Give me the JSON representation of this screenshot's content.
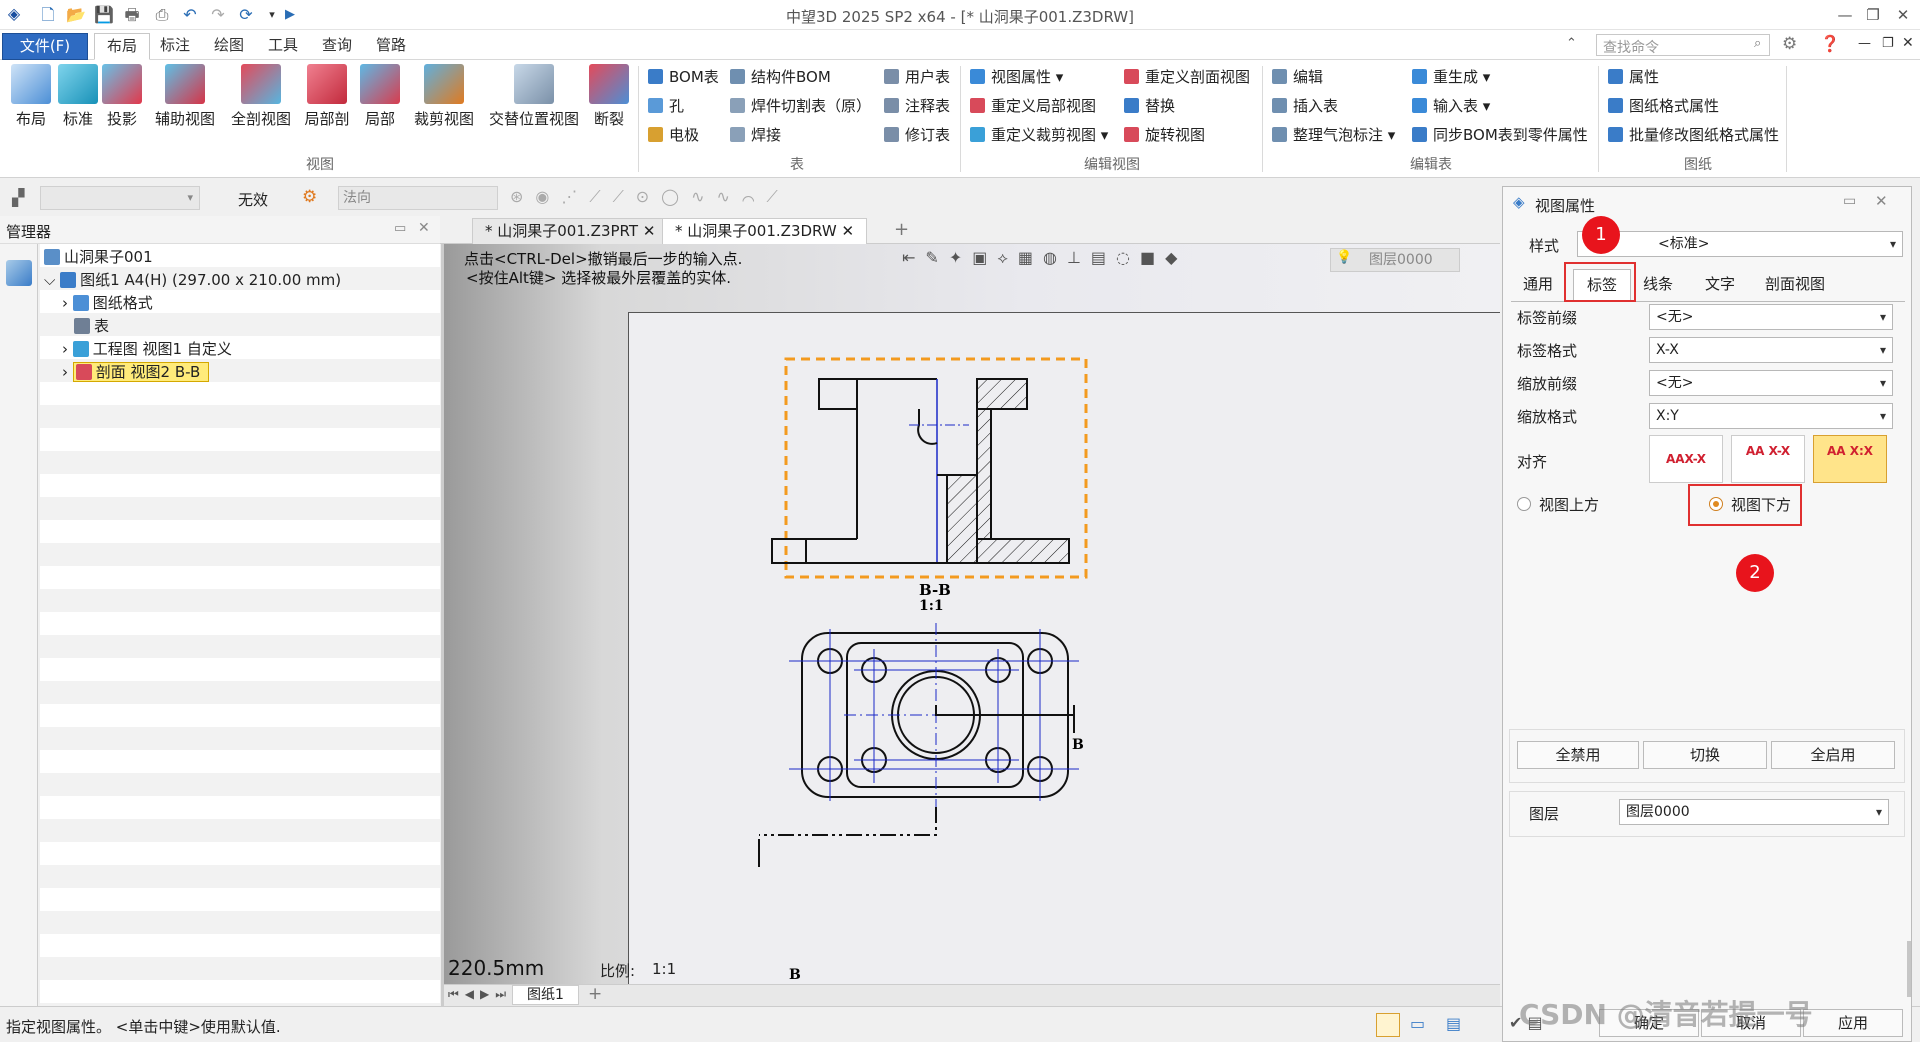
{
  "titlebar": {
    "title": "中望3D 2025 SP2 x64 - [* 山洞果子001.Z3DRW]"
  },
  "menu": {
    "file": "文件(F)",
    "tabs": [
      "布局",
      "标注",
      "绘图",
      "工具",
      "查询",
      "管路"
    ],
    "search_placeholder": "查找命令"
  },
  "ribbon": {
    "view_buttons": [
      "布局",
      "标准",
      "投影",
      "辅助视图",
      "全剖视图",
      "局部剖",
      "局部",
      "裁剪视图",
      "交替位置视图",
      "断裂"
    ],
    "view_group": "视图",
    "table_items": [
      "BOM表",
      "孔",
      "电极",
      "结构件BOM",
      "焊件切割表（原）",
      "焊接",
      "用户表",
      "注释表",
      "修订表"
    ],
    "table_group": "表",
    "edit_view_items": [
      "视图属性",
      "重定义局部视图",
      "重定义裁剪视图",
      "重定义剖面视图",
      "替换",
      "旋转视图"
    ],
    "edit_view_group": "编辑视图",
    "edit_table_items": [
      "编辑",
      "插入表",
      "整理气泡标注",
      "重生成",
      "输入表",
      "同步BOM表到零件属性"
    ],
    "edit_table_group": "编辑表",
    "sheet_items": [
      "属性",
      "图纸格式属性",
      "批量修改图纸格式属性"
    ],
    "sheet_group": "图纸"
  },
  "toolbar2": {
    "status": "无效",
    "direction": "法向"
  },
  "manager": {
    "title": "管理器",
    "tree": [
      "山洞果子001",
      "图纸1 A4(H) (297.00 x 210.00 mm)",
      "图纸格式",
      "表",
      "工程图 视图1 自定义",
      "剖面 视图2 B-B"
    ]
  },
  "doc_tabs": [
    "* 山洞果子001.Z3PRT",
    "* 山洞果子001.Z3DRW"
  ],
  "canvas": {
    "hint1": "点击<CTRL-Del>撤销最后一步的输入点.",
    "hint2": "<按住Alt键> 选择被最外层覆盖的实体.",
    "layer": "图层0000",
    "section_label": "B-B",
    "section_scale": "1:1",
    "cut_label": "B",
    "dim": "220.5mm",
    "scale_label": "比例:",
    "scale_value": "1:1",
    "sheet_tab": "图纸1"
  },
  "status": {
    "text": "指定视图属性。 <单击中键>使用默认值."
  },
  "panel": {
    "title": "视图属性",
    "style_label": "样式",
    "style_value": "<标准>",
    "tabs": [
      "通用",
      "标签",
      "线条",
      "文字",
      "剖面视图"
    ],
    "rows": [
      {
        "label": "标签前缀",
        "value": "<无>"
      },
      {
        "label": "标签格式",
        "value": "X-X"
      },
      {
        "label": "缩放前缀",
        "value": "<无>"
      },
      {
        "label": "缩放格式",
        "value": "X:Y"
      }
    ],
    "align_label": "对齐",
    "align_opts": [
      "AAX-X",
      "AA X-X",
      "AA X:X"
    ],
    "radio_above": "视图上方",
    "radio_below": "视图下方",
    "btn_disable": "全禁用",
    "btn_toggle": "切换",
    "btn_enable": "全启用",
    "layer_label": "图层",
    "layer_value": "图层0000",
    "ok": "确定",
    "cancel": "取消",
    "apply": "应用",
    "badge1": "1",
    "badge2": "2"
  },
  "watermark": "CSDN @清音若提一号"
}
